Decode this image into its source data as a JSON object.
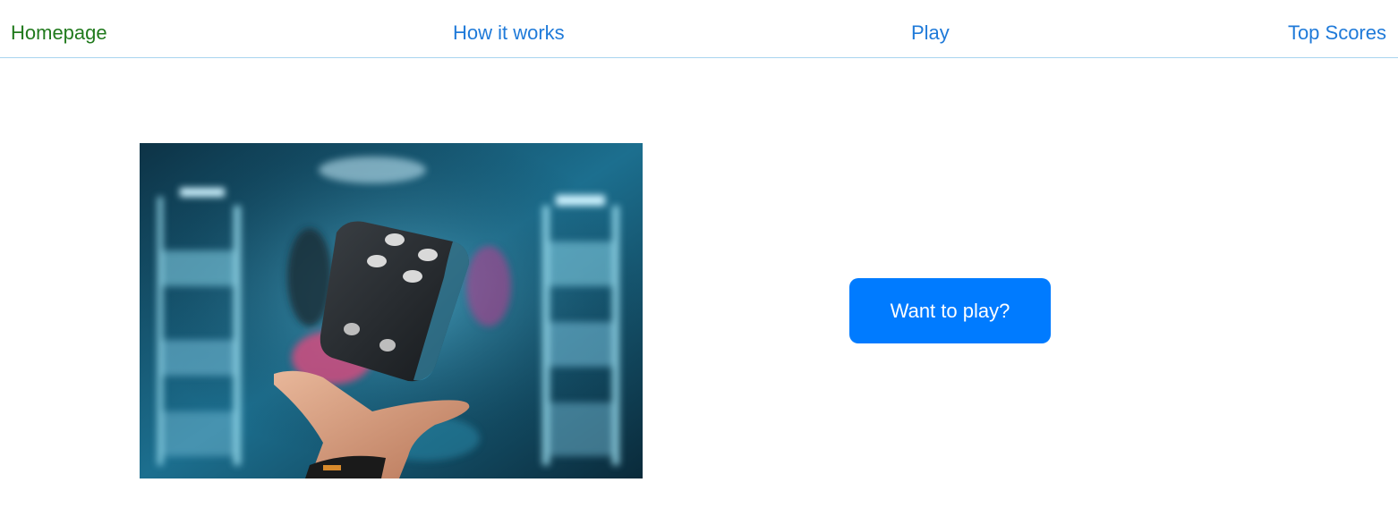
{
  "nav": {
    "items": [
      {
        "label": "Homepage",
        "active": true
      },
      {
        "label": "How it works",
        "active": false
      },
      {
        "label": "Play",
        "active": false
      },
      {
        "label": "Top Scores",
        "active": false
      }
    ]
  },
  "hero": {
    "image_icon": "dice-photo"
  },
  "cta": {
    "label": "Want to play?"
  },
  "colors": {
    "link": "#1f7ad9",
    "active_link": "#217a1d",
    "button": "#007bff",
    "nav_border": "#a9d4ef"
  }
}
